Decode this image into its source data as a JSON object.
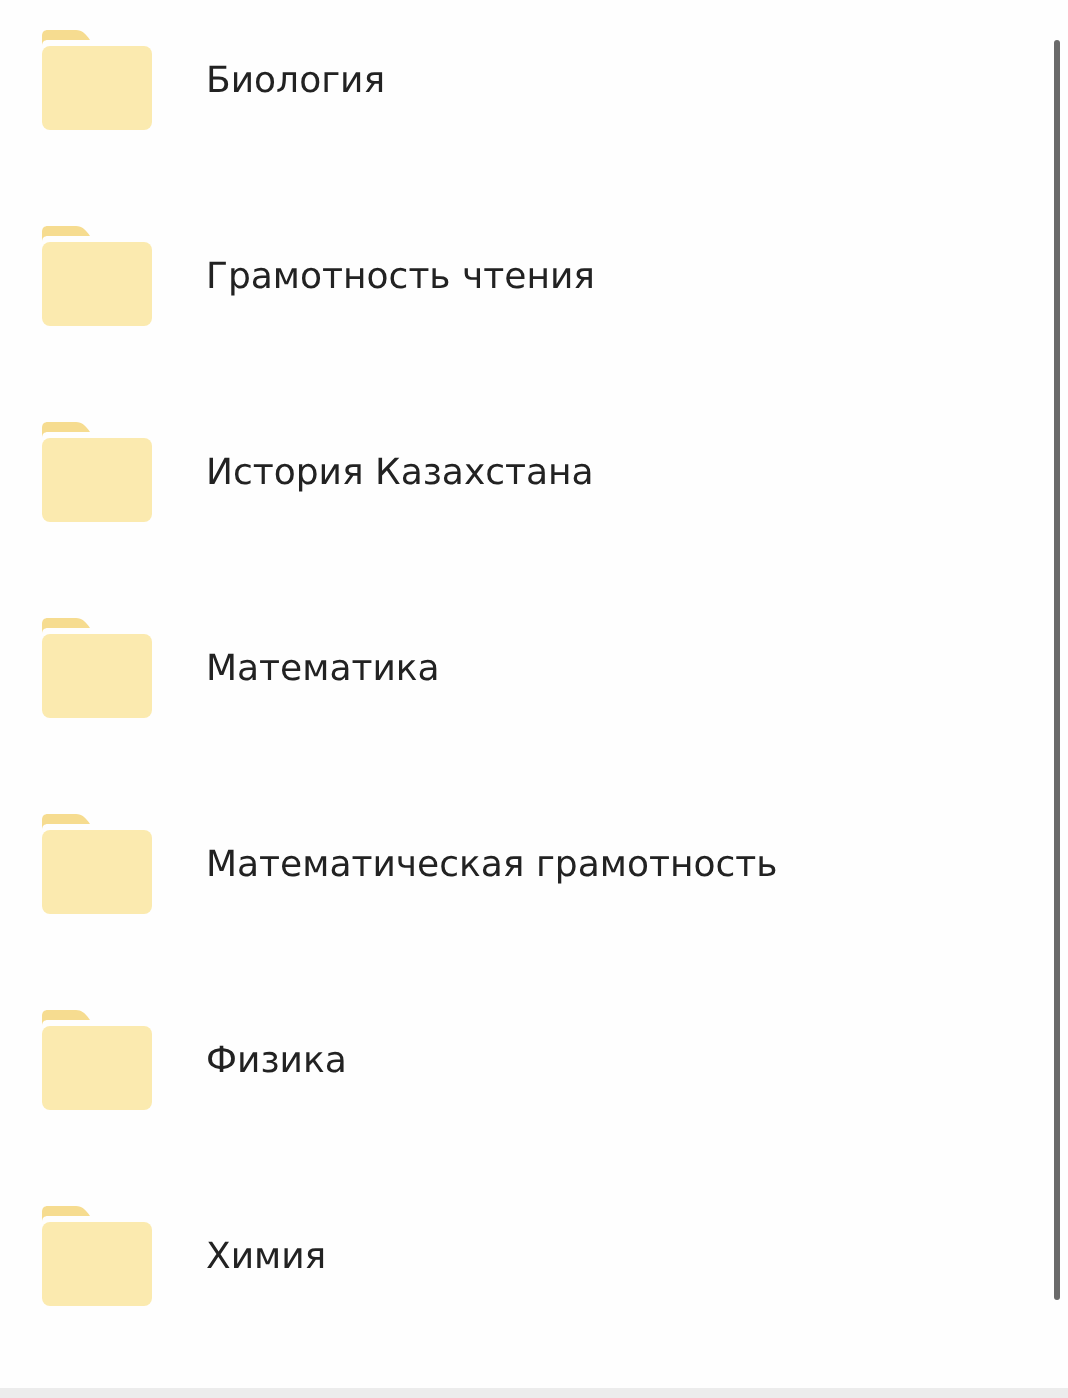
{
  "folders": [
    {
      "name": "Биология"
    },
    {
      "name": "Грамотность чтения"
    },
    {
      "name": "История Казахстана"
    },
    {
      "name": "Математика"
    },
    {
      "name": "Математическая грамотность"
    },
    {
      "name": "Физика"
    },
    {
      "name": "Химия"
    }
  ]
}
